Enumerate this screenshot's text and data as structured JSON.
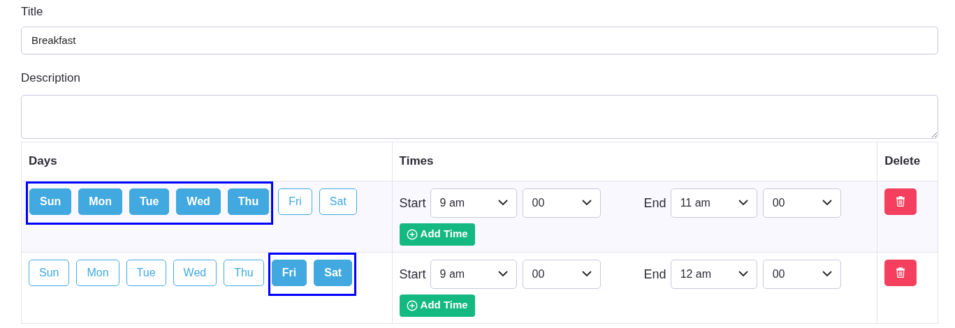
{
  "title_field": {
    "label": "Title",
    "value": "Breakfast"
  },
  "description_field": {
    "label": "Description"
  },
  "table": {
    "columns": [
      "Days",
      "Times",
      "Delete"
    ],
    "rows": [
      {
        "highlighted": true,
        "days": [
          {
            "label": "Sun",
            "selected": true
          },
          {
            "label": "Mon",
            "selected": true
          },
          {
            "label": "Tue",
            "selected": true
          },
          {
            "label": "Wed",
            "selected": true
          },
          {
            "label": "Thu",
            "selected": true
          },
          {
            "label": "Fri",
            "selected": false
          },
          {
            "label": "Sat",
            "selected": false
          }
        ],
        "start_label": "Start",
        "start_hour": "9 am",
        "start_minute": "00",
        "end_label": "End",
        "end_hour": "11 am",
        "end_minute": "00",
        "add_button": "Add Time"
      },
      {
        "highlighted": true,
        "days": [
          {
            "label": "Sun",
            "selected": false
          },
          {
            "label": "Mon",
            "selected": false
          },
          {
            "label": "Tue",
            "selected": false
          },
          {
            "label": "Wed",
            "selected": false
          },
          {
            "label": "Thu",
            "selected": false
          },
          {
            "label": "Fri",
            "selected": true
          },
          {
            "label": "Sat",
            "selected": true
          }
        ],
        "start_label": "Start",
        "start_hour": "9 am",
        "start_minute": "00",
        "end_label": "End",
        "end_hour": "12 am",
        "end_minute": "00",
        "add_button": "Add Time"
      }
    ]
  }
}
